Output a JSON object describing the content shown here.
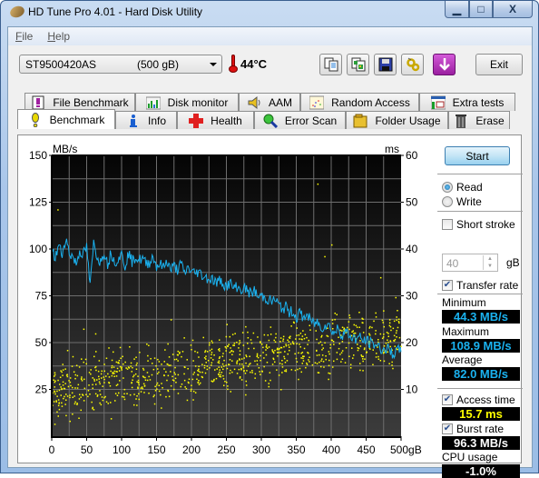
{
  "window": {
    "title": "HD Tune Pro 4.01 - Hard Disk Utility",
    "controls": {
      "minimize": "▁",
      "maximize": "□",
      "close": "X"
    }
  },
  "menu": [
    {
      "label": "File",
      "mnemonic": "F",
      "rest": "ile"
    },
    {
      "label": "Help",
      "mnemonic": "H",
      "rest": "elp"
    }
  ],
  "toolbar": {
    "drive_name": "ST9500420AS",
    "drive_size": "(500 gB)",
    "temperature": "44°C",
    "icons": [
      "copy-text-icon",
      "copy-screenshot-icon",
      "save-icon",
      "options-icon",
      "download-icon"
    ],
    "exit_label": "Exit"
  },
  "tabs": {
    "top_row": [
      {
        "label": "File Benchmark",
        "icon": "file-benchmark-icon"
      },
      {
        "label": "Disk monitor",
        "icon": "disk-monitor-icon"
      },
      {
        "label": "AAM",
        "icon": "speaker-icon"
      },
      {
        "label": "Random Access",
        "icon": "random-access-icon"
      },
      {
        "label": "Extra tests",
        "icon": "extra-tests-icon"
      }
    ],
    "bottom_row": [
      {
        "label": "Benchmark",
        "icon": "exclamation-icon",
        "active": true
      },
      {
        "label": "Info",
        "icon": "info-icon"
      },
      {
        "label": "Health",
        "icon": "red-cross-icon"
      },
      {
        "label": "Error Scan",
        "icon": "magnifier-icon"
      },
      {
        "label": "Folder Usage",
        "icon": "folder-icon"
      },
      {
        "label": "Erase",
        "icon": "trash-icon"
      }
    ]
  },
  "side": {
    "start_label": "Start",
    "read_label": "Read",
    "write_label": "Write",
    "mode_selected": "Read",
    "short_stroke_label": "Short stroke",
    "short_stroke_checked": false,
    "short_stroke_value": "40",
    "short_stroke_unit": "gB",
    "transfer_rate_label": "Transfer rate",
    "transfer_rate_checked": true,
    "minimum_label": "Minimum",
    "minimum_value": "44.3 MB/s",
    "maximum_label": "Maximum",
    "maximum_value": "108.9 MB/s",
    "average_label": "Average",
    "average_value": "82.0 MB/s",
    "access_time_label": "Access time",
    "access_time_checked": true,
    "access_time_value": "15.7 ms",
    "burst_rate_label": "Burst rate",
    "burst_rate_checked": true,
    "burst_rate_value": "96.3 MB/s",
    "cpu_usage_label": "CPU usage",
    "cpu_usage_value": "-1.0%",
    "colors": {
      "transfer": "#1ab2f0",
      "access": "#ffff00",
      "burst": "#ffffff",
      "cpu": "#ffffff"
    }
  },
  "chart_data": {
    "type": "line",
    "title": "",
    "xlabel": "gB",
    "ylabel": "MB/s",
    "y2label": "ms",
    "xlim": [
      0,
      500
    ],
    "ylim": [
      0,
      150
    ],
    "y2lim": [
      0,
      60
    ],
    "x_ticks": [
      0,
      50,
      100,
      150,
      200,
      250,
      300,
      350,
      400,
      450,
      500
    ],
    "x_tick_labels": [
      "0",
      "50",
      "100",
      "150",
      "200",
      "250",
      "300",
      "350",
      "400",
      "450",
      "500gB"
    ],
    "y_ticks": [
      25,
      50,
      75,
      100,
      125,
      150
    ],
    "y2_ticks": [
      10,
      20,
      30,
      40,
      50,
      60
    ],
    "grid": true,
    "series": [
      {
        "name": "Transfer rate (MB/s)",
        "axis": "left",
        "color": "#1ab2f0",
        "x": [
          0,
          5,
          10,
          15,
          20,
          25,
          30,
          35,
          40,
          45,
          50,
          55,
          60,
          65,
          70,
          75,
          80,
          85,
          90,
          95,
          100,
          105,
          110,
          115,
          120,
          125,
          130,
          135,
          140,
          145,
          150,
          155,
          160,
          165,
          170,
          175,
          180,
          185,
          190,
          195,
          200,
          205,
          210,
          215,
          220,
          225,
          230,
          235,
          240,
          245,
          250,
          255,
          260,
          265,
          270,
          275,
          280,
          285,
          290,
          295,
          300,
          305,
          310,
          315,
          320,
          325,
          330,
          335,
          340,
          345,
          350,
          355,
          360,
          365,
          370,
          375,
          380,
          385,
          390,
          395,
          400,
          405,
          410,
          415,
          420,
          425,
          430,
          435,
          440,
          445,
          450,
          455,
          460,
          465,
          470,
          475,
          480,
          485,
          490,
          495,
          500
        ],
        "values": [
          100,
          95,
          102,
          97,
          106,
          98,
          96,
          92,
          99,
          97,
          101,
          80,
          103,
          96,
          93,
          99,
          92,
          98,
          93,
          95,
          97,
          91,
          98,
          93,
          96,
          94,
          95,
          92,
          93,
          96,
          91,
          92,
          90,
          94,
          89,
          91,
          89,
          92,
          87,
          90,
          88,
          87,
          88,
          86,
          85,
          84,
          84,
          82,
          83,
          82,
          80,
          82,
          79,
          80,
          78,
          79,
          78,
          76,
          78,
          74,
          75,
          74,
          73,
          72,
          73,
          70,
          68,
          69,
          66,
          67,
          63,
          66,
          63,
          65,
          62,
          60,
          61,
          58,
          59,
          60,
          57,
          55,
          58,
          54,
          56,
          54,
          53,
          52,
          53,
          51,
          51,
          50,
          49,
          49,
          47,
          46,
          47,
          45,
          44,
          46,
          45
        ]
      },
      {
        "name": "Access time (ms)",
        "axis": "right",
        "color": "#ffff00",
        "summary": "scatter trend from ~10 ms at 0 gB to ~22 ms at 500 gB, spread about ±5 ms, outliers up to ~54 ms"
      }
    ]
  }
}
